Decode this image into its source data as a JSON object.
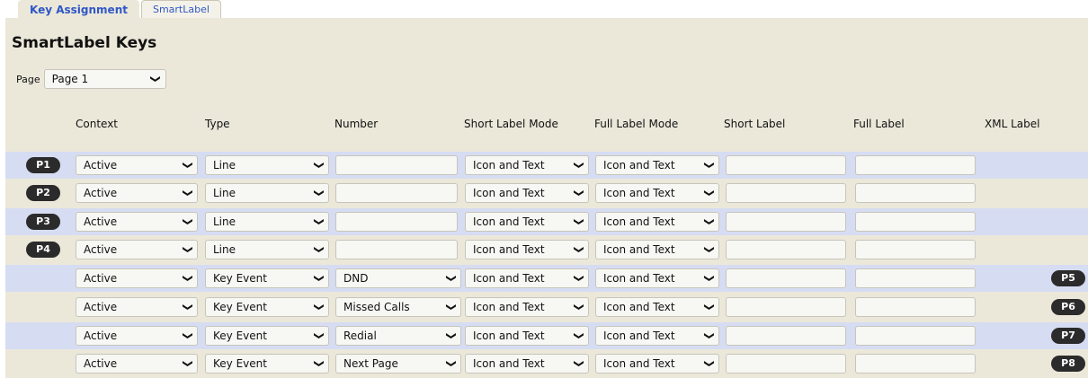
{
  "tabs": [
    "Key Assignment",
    "SmartLabel"
  ],
  "title": "SmartLabel Keys",
  "page_selector": {
    "label": "Page",
    "value": "Page 1"
  },
  "columns": [
    "Context",
    "Type",
    "Number",
    "Short Label Mode",
    "Full Label Mode",
    "Short Label",
    "Full Label",
    "XML Label"
  ],
  "rows": [
    {
      "key": "P1",
      "context": "Active",
      "type": "Line",
      "number": "",
      "short_mode": "Icon and Text",
      "full_mode": "Icon and Text",
      "short_label": "",
      "full_label": ""
    },
    {
      "key": "P2",
      "context": "Active",
      "type": "Line",
      "number": "",
      "short_mode": "Icon and Text",
      "full_mode": "Icon and Text",
      "short_label": "",
      "full_label": ""
    },
    {
      "key": "P3",
      "context": "Active",
      "type": "Line",
      "number": "",
      "short_mode": "Icon and Text",
      "full_mode": "Icon and Text",
      "short_label": "",
      "full_label": ""
    },
    {
      "key": "P4",
      "context": "Active",
      "type": "Line",
      "number": "",
      "short_mode": "Icon and Text",
      "full_mode": "Icon and Text",
      "short_label": "",
      "full_label": ""
    },
    {
      "key": "P5",
      "context": "Active",
      "type": "Key Event",
      "number": "DND",
      "short_mode": "Icon and Text",
      "full_mode": "Icon and Text",
      "short_label": "",
      "full_label": ""
    },
    {
      "key": "P6",
      "context": "Active",
      "type": "Key Event",
      "number": "Missed Calls",
      "short_mode": "Icon and Text",
      "full_mode": "Icon and Text",
      "short_label": "",
      "full_label": ""
    },
    {
      "key": "P7",
      "context": "Active",
      "type": "Key Event",
      "number": "Redial",
      "short_mode": "Icon and Text",
      "full_mode": "Icon and Text",
      "short_label": "",
      "full_label": ""
    },
    {
      "key": "P8",
      "context": "Active",
      "type": "Key Event",
      "number": "Next Page",
      "short_mode": "Icon and Text",
      "full_mode": "Icon and Text",
      "short_label": "",
      "full_label": ""
    }
  ],
  "colors": {
    "panel": "#ebe8da",
    "row_highlight": "#d6dcf2",
    "tab_text": "#2f57c6",
    "badge": "#2b2b2b"
  }
}
